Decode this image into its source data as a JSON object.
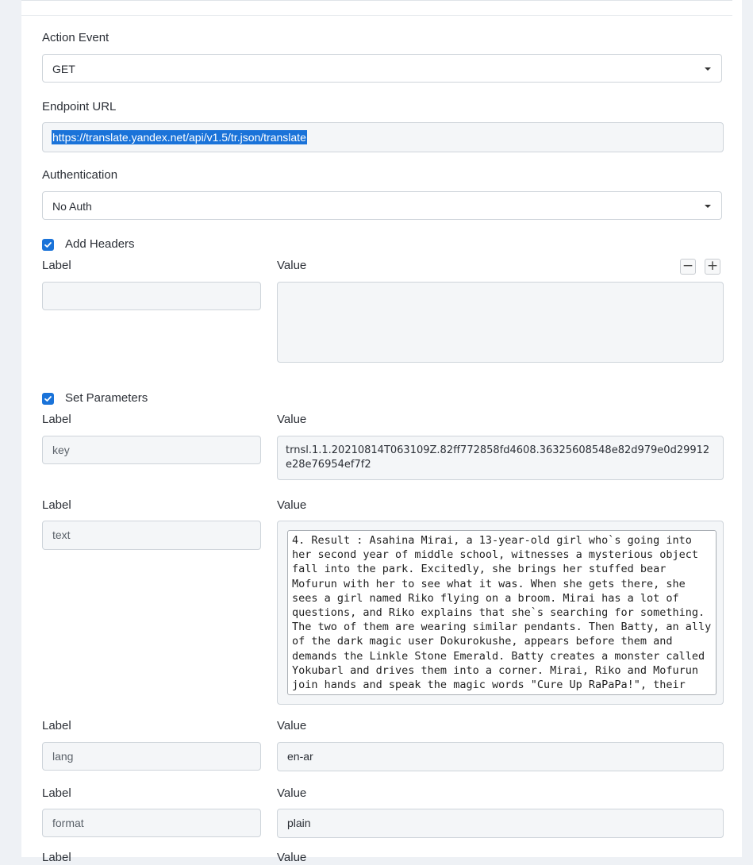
{
  "form": {
    "action_event": {
      "label": "Action Event",
      "value": "GET"
    },
    "endpoint": {
      "label": "Endpoint URL",
      "value": "https://translate.yandex.net/api/v1.5/tr.json/translate"
    },
    "authentication": {
      "label": "Authentication",
      "value": "No Auth"
    },
    "headers": {
      "checkbox_label": "Add Headers",
      "checked": true,
      "label_header": "Label",
      "value_header": "Value",
      "remove_icon": "minus-icon",
      "add_icon": "plus-icon",
      "remove_glyph": "−",
      "add_glyph": "+",
      "rows": [
        {
          "label": "",
          "value": ""
        }
      ]
    },
    "parameters": {
      "checkbox_label": "Set Parameters",
      "checked": true,
      "label_header": "Label",
      "value_header": "Value",
      "rows": [
        {
          "label": "key",
          "value": "trnsl.1.1.20210814T063109Z.82ff772858fd4608.36325608548e82d979e0d29912e28e76954ef7f2"
        },
        {
          "label": "text",
          "value": "4. Result : Asahina Mirai, a 13-year-old girl who`s going into her second year of middle school, witnesses a mysterious object fall into the park. Excitedly, she brings her stuffed bear Mofurun with her to see what it was. When she gets there, she sees a girl named Riko flying on a broom. Mirai has a lot of questions, and Riko explains that she`s searching for something. The two of them are wearing similar pendants. Then Batty, an ally of the dark magic user Dokurokushe, appears before them and demands the Linkle Stone Emerald. Batty creates a monster called Yokubarl and drives them into a corner. Mirai, Riko and Mofurun join hands and speak the magic words \"Cure Up RaPaPa!\", their pendants glow, and they become the legendary Precure."
        },
        {
          "label": "lang",
          "value": "en-ar"
        },
        {
          "label": "format",
          "value": "plain"
        }
      ]
    }
  },
  "colors": {
    "accent": "#1a73d9",
    "page_bg": "#eef1f5",
    "field_bg": "#f4f6f8",
    "border": "#ced4da"
  },
  "icons": {
    "checkbox": "checkmark-icon",
    "dropdown": "caret-down-icon"
  }
}
